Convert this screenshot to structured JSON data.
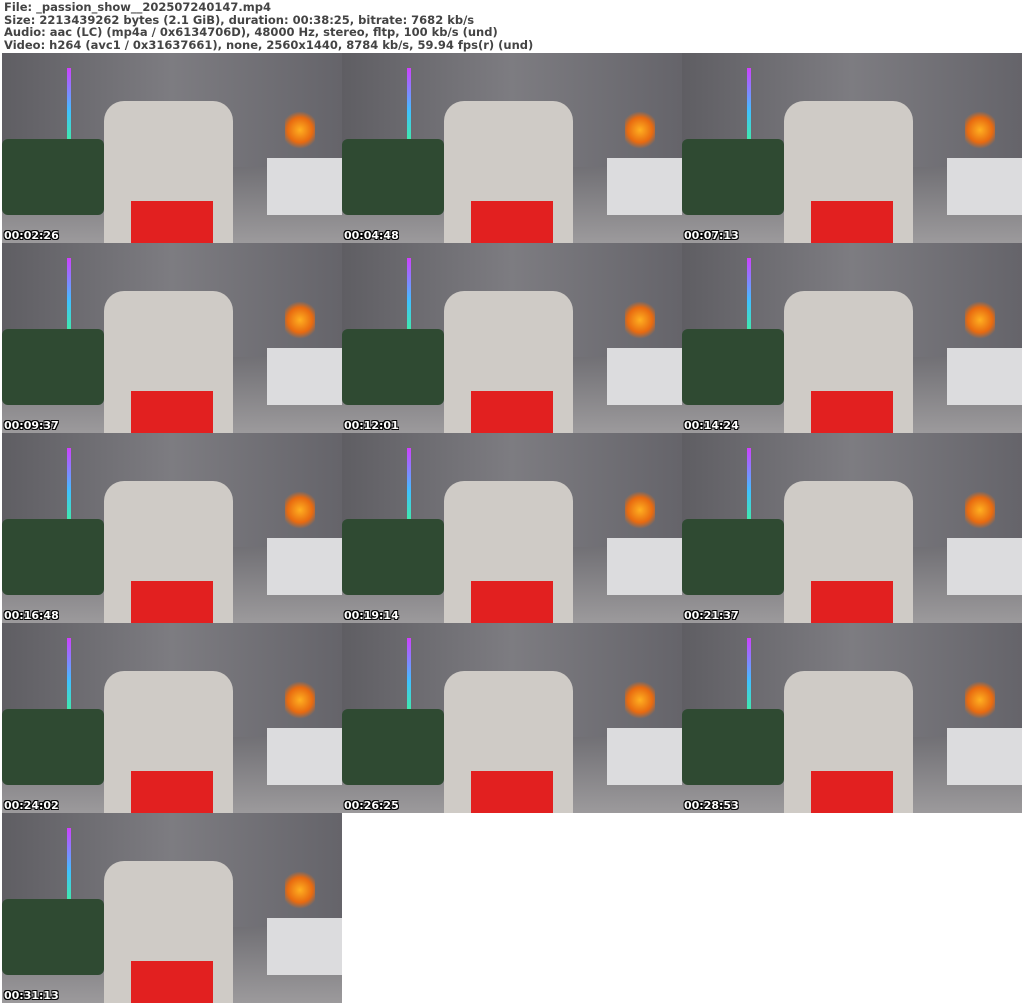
{
  "header": {
    "file": "File: _passion_show__202507240147.mp4",
    "size": "Size: 2213439262 bytes (2.1 GiB), duration: 00:38:25, bitrate: 7682 kb/s",
    "audio": "Audio: aac (LC) (mp4a / 0x6134706D), 48000 Hz, stereo, fltp, 100 kb/s (und)",
    "video": "Video: h264 (avc1 / 0x31637661), none, 2560x1440, 8784 kb/s, 59.94 fps(r) (und)"
  },
  "thumbnails": [
    {
      "timestamp": "00:02:26"
    },
    {
      "timestamp": "00:04:48"
    },
    {
      "timestamp": "00:07:13"
    },
    {
      "timestamp": "00:09:37"
    },
    {
      "timestamp": "00:12:01"
    },
    {
      "timestamp": "00:14:24"
    },
    {
      "timestamp": "00:16:48"
    },
    {
      "timestamp": "00:19:14"
    },
    {
      "timestamp": "00:21:37"
    },
    {
      "timestamp": "00:24:02"
    },
    {
      "timestamp": "00:26:25"
    },
    {
      "timestamp": "00:28:53"
    },
    {
      "timestamp": "00:31:13"
    }
  ]
}
